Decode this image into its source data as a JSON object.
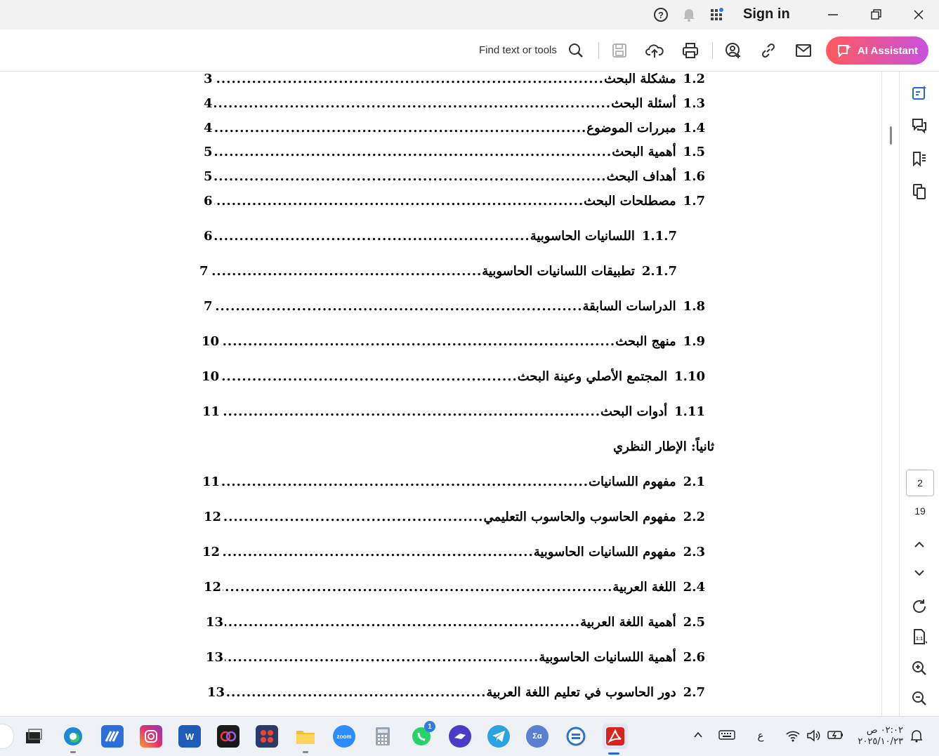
{
  "titlebar": {
    "sign_in": "Sign in"
  },
  "toolbar": {
    "find_label": "Find text or tools",
    "ai_assistant_label": "AI Assistant"
  },
  "document": {
    "toc": [
      {
        "num": "1.2",
        "title": "مشكلة البحث",
        "page": "3"
      },
      {
        "num": "1.3",
        "title": "أسئلة البحث",
        "page": "4"
      },
      {
        "num": "1.4",
        "title": "مبررات الموضوع",
        "page": "4"
      },
      {
        "num": "1.5",
        "title": "أهمية البحث",
        "page": "5"
      },
      {
        "num": "1.6",
        "title": "أهداف البحث",
        "page": "5"
      },
      {
        "num": "1.7",
        "title": "مصطلحات البحث",
        "page": "6"
      },
      {
        "num": "1.1.7",
        "title": "اللسانيات الحاسوبية",
        "page": "6"
      },
      {
        "num": "2.1.7",
        "title": "تطبيقات اللسانيات الحاسوبية",
        "page": "7"
      },
      {
        "num": "1.8",
        "title": "الدراسات السابقة",
        "page": "7"
      },
      {
        "num": "1.9",
        "title": "منهج البحث",
        "page": "10"
      },
      {
        "num": "1.10",
        "title": "المجتمع الأصلي وعينة البحث",
        "page": "10"
      },
      {
        "num": "1.11",
        "title": "أدوات البحث",
        "page": "11"
      },
      {
        "num": "2.1",
        "title": "مفهوم اللسانيات",
        "page": "11"
      },
      {
        "num": "2.2",
        "title": "مفهوم الحاسوب والحاسوب التعليمي",
        "page": "12"
      },
      {
        "num": "2.3",
        "title": "مفهوم اللسانيات الحاسوبية",
        "page": "12"
      },
      {
        "num": "2.4",
        "title": "اللغة العربية",
        "page": "12"
      },
      {
        "num": "2.5",
        "title": "أهمية اللغة العربية",
        "page": "13"
      },
      {
        "num": "2.6",
        "title": "أهمية اللسانيات الحاسوبية",
        "page": "13"
      },
      {
        "num": "2.7",
        "title": "دور الحاسوب في تعليم اللغة العربية",
        "page": "13"
      }
    ],
    "section_heading": "ثانياً: الإطار النظري"
  },
  "page_nav": {
    "current_page": "2",
    "total_pages": "19"
  },
  "taskbar": {
    "whatsapp_badge": "1",
    "ime_label": "ع",
    "time": "٠٢:٠٢ ص",
    "date": "٢٠٢٥/١٠/٢٣"
  },
  "colors": {
    "ai_gradient_start": "#ff5a5a",
    "ai_gradient_end": "#c94fe0",
    "pdf_red": "#d9231f"
  }
}
